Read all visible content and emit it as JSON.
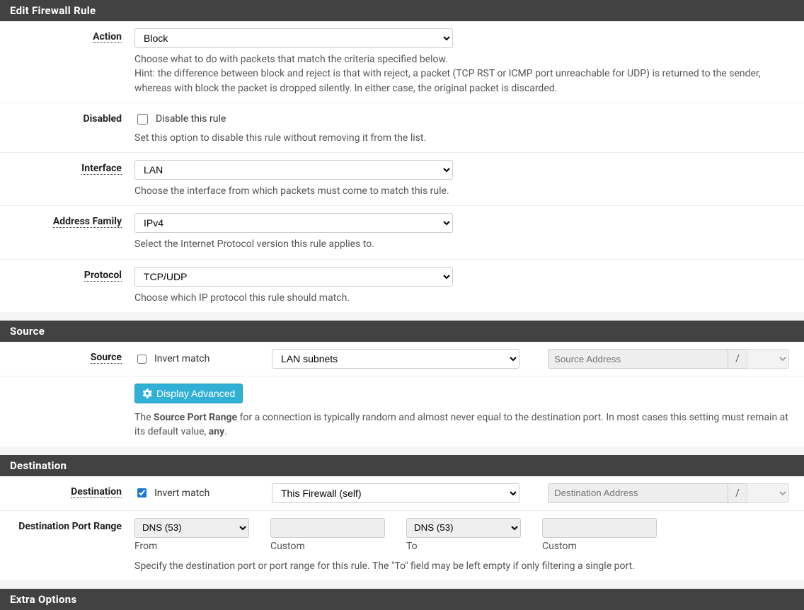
{
  "headers": {
    "edit": "Edit Firewall Rule",
    "source": "Source",
    "destination": "Destination",
    "extra": "Extra Options"
  },
  "action": {
    "label": "Action",
    "value": "Block",
    "help": "Choose what to do with packets that match the criteria specified below.",
    "hint": "Hint: the difference between block and reject is that with reject, a packet (TCP RST or ICMP port unreachable for UDP) is returned to the sender, whereas with block the packet is dropped silently. In either case, the original packet is discarded."
  },
  "disabled": {
    "label": "Disabled",
    "chk_label": "Disable this rule",
    "help": "Set this option to disable this rule without removing it from the list."
  },
  "interface": {
    "label": "Interface",
    "value": "LAN",
    "help": "Choose the interface from which packets must come to match this rule."
  },
  "address_family": {
    "label": "Address Family",
    "value": "IPv4",
    "help": "Select the Internet Protocol version this rule applies to."
  },
  "protocol": {
    "label": "Protocol",
    "value": "TCP/UDP",
    "help": "Choose which IP protocol this rule should match."
  },
  "source": {
    "label": "Source",
    "invert_label": "Invert match",
    "type_value": "LAN subnets",
    "addr_placeholder": "Source Address",
    "slash": "/",
    "display_advanced": "Display Advanced",
    "help_prefix": "The ",
    "help_bold": "Source Port Range",
    "help_middle": " for a connection is typically random and almost never equal to the destination port. In most cases this setting must remain at its default value, ",
    "help_any": "any",
    "help_suffix": "."
  },
  "destination": {
    "label": "Destination",
    "invert_label": "Invert match",
    "type_value": "This Firewall (self)",
    "addr_placeholder": "Destination Address",
    "slash": "/"
  },
  "dest_port": {
    "label": "Destination Port Range",
    "from_value": "DNS (53)",
    "from_label": "From",
    "custom_label": "Custom",
    "to_value": "DNS (53)",
    "to_label": "To",
    "help": "Specify the destination port or port range for this rule. The \"To\" field may be left empty if only filtering a single port."
  }
}
